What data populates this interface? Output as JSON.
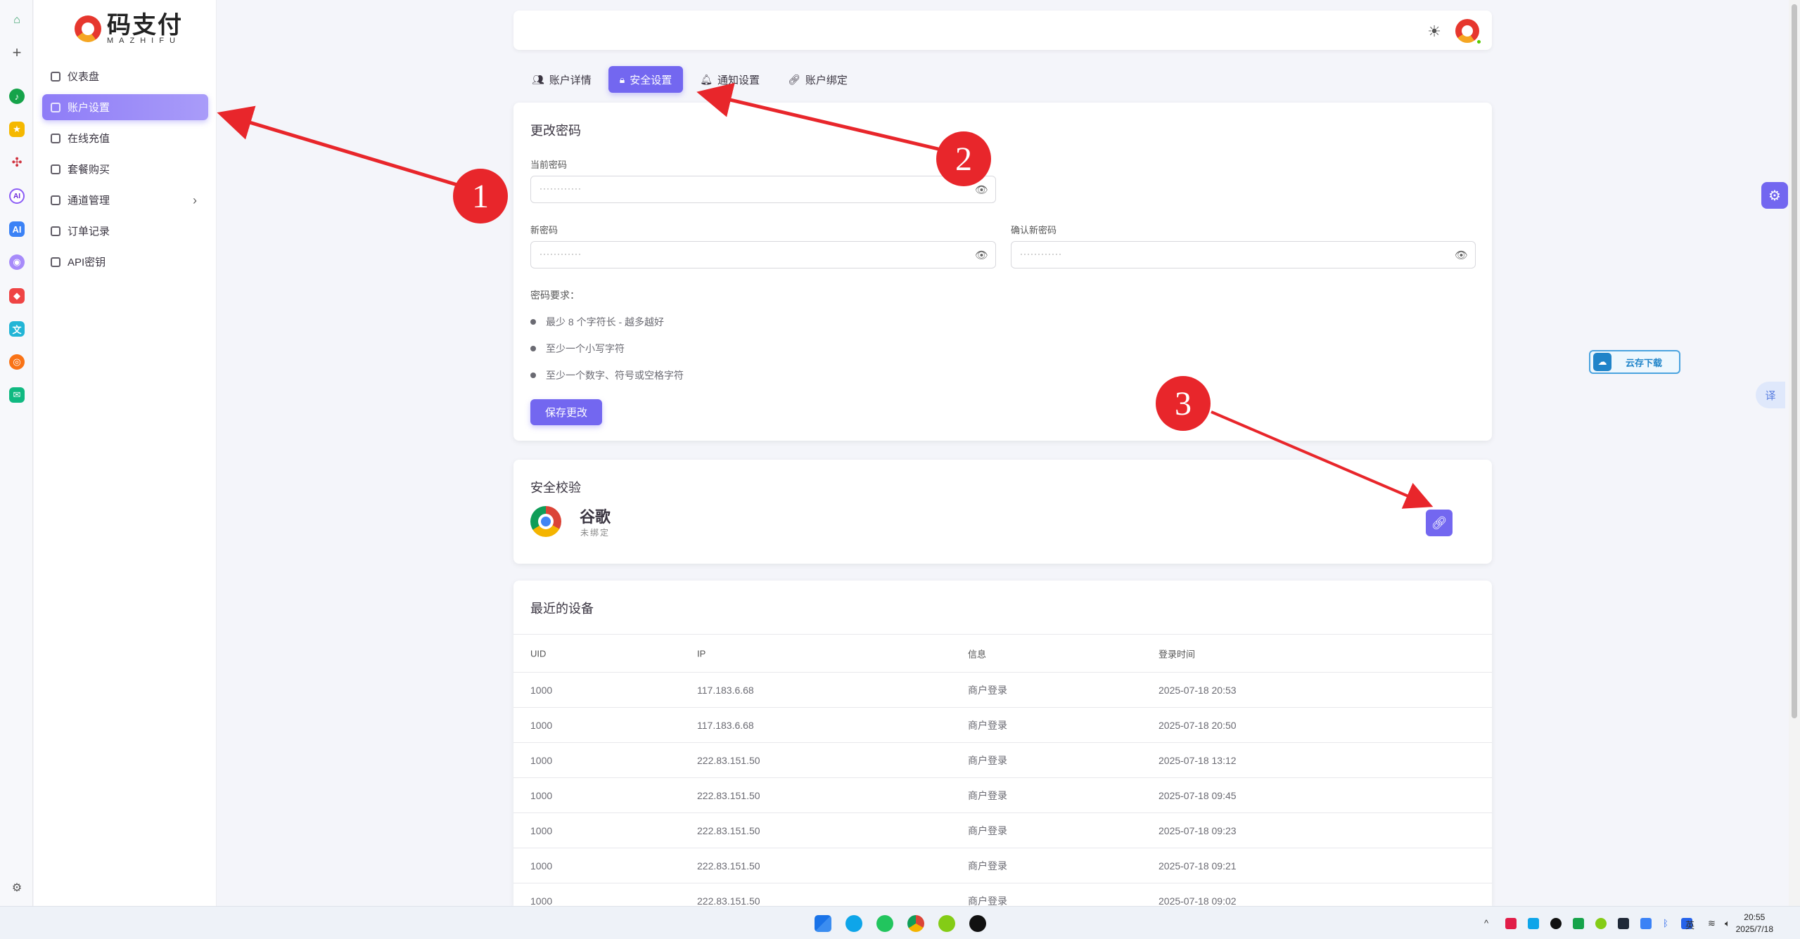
{
  "brand": {
    "name_cn": "码支付",
    "name_en": "MAZHIFU"
  },
  "sidebar": {
    "items": [
      {
        "label": "仪表盘"
      },
      {
        "label": "账户设置"
      },
      {
        "label": "在线充值"
      },
      {
        "label": "套餐购买"
      },
      {
        "label": "通道管理"
      },
      {
        "label": "订单记录"
      },
      {
        "label": "API密钥"
      }
    ]
  },
  "tabs": [
    {
      "label": "账户详情"
    },
    {
      "label": "安全设置"
    },
    {
      "label": "通知设置"
    },
    {
      "label": "账户绑定"
    }
  ],
  "password_card": {
    "title": "更改密码",
    "current_label": "当前密码",
    "new_label": "新密码",
    "confirm_label": "确认新密码",
    "mask": "············",
    "requirements_title": "密码要求：",
    "requirements": [
      "最少 8 个字符长 - 越多越好",
      "至少一个小写字符",
      "至少一个数字、符号或空格字符"
    ],
    "save_label": "保存更改"
  },
  "security_card": {
    "title": "安全校验",
    "provider_name": "谷歌",
    "provider_status": "未绑定"
  },
  "devices_card": {
    "title": "最近的设备",
    "columns": [
      "UID",
      "IP",
      "信息",
      "登录时间"
    ],
    "rows": [
      [
        "1000",
        "117.183.6.68",
        "商户登录",
        "2025-07-18 20:53"
      ],
      [
        "1000",
        "117.183.6.68",
        "商户登录",
        "2025-07-18 20:50"
      ],
      [
        "1000",
        "222.83.151.50",
        "商户登录",
        "2025-07-18 13:12"
      ],
      [
        "1000",
        "222.83.151.50",
        "商户登录",
        "2025-07-18 09:45"
      ],
      [
        "1000",
        "222.83.151.50",
        "商户登录",
        "2025-07-18 09:23"
      ],
      [
        "1000",
        "222.83.151.50",
        "商户登录",
        "2025-07-18 09:21"
      ],
      [
        "1000",
        "222.83.151.50",
        "商户登录",
        "2025-07-18 09:02"
      ]
    ]
  },
  "floating": {
    "cloud_download": "云存下载",
    "translate": "译"
  },
  "annotations": [
    "1",
    "2",
    "3"
  ],
  "taskbar": {
    "time": "20:55",
    "date": "2025/7/18",
    "ime": "英"
  },
  "colors": {
    "primary": "#7367f0",
    "annotation_red": "#e8262b"
  }
}
